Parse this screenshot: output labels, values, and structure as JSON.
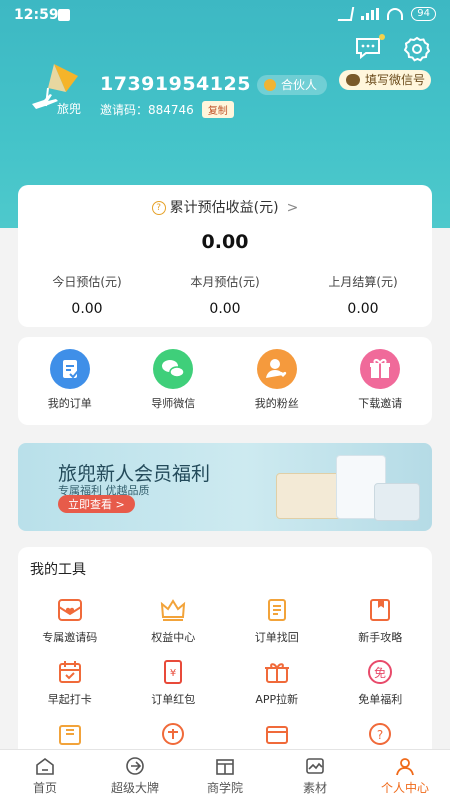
{
  "status_bar": {
    "time": "12:59",
    "battery": "94"
  },
  "colors": {
    "header": "#44c3c9",
    "accent": "#f06a1a",
    "badge_bg": "#fff6dc"
  },
  "header": {
    "phone": "17391954125",
    "partner_badge": "合伙人",
    "wechat_button": "填写微信号",
    "invite_label": "邀请码：884746",
    "copy_label": "复制",
    "logo_text": "旅兜"
  },
  "earnings": {
    "title": "累计预估收益(元)",
    "total": "0.00",
    "columns": [
      {
        "label": "今日预估(元)",
        "value": "0.00"
      },
      {
        "label": "本月预估(元)",
        "value": "0.00"
      },
      {
        "label": "上月结算(元)",
        "value": "0.00"
      }
    ]
  },
  "quick_links": [
    {
      "label": "我的订单",
      "icon": "order-icon",
      "color": "#3f8fe8"
    },
    {
      "label": "导师微信",
      "icon": "wechat-icon",
      "color": "#3fcf7a"
    },
    {
      "label": "我的粉丝",
      "icon": "fans-icon",
      "color": "#f59a3d"
    },
    {
      "label": "下载邀请",
      "icon": "gift-icon",
      "color": "#f06a9a"
    }
  ],
  "banner": {
    "title": "旅兜新人会员福利",
    "subtitle": "专属福利 优越品质",
    "button": "立即查看 >"
  },
  "tools": {
    "title": "我的工具",
    "items": [
      {
        "label": "专属邀请码",
        "icon": "invite-code-icon"
      },
      {
        "label": "权益中心",
        "icon": "crown-icon"
      },
      {
        "label": "订单找回",
        "icon": "order-recover-icon"
      },
      {
        "label": "新手攻略",
        "icon": "guide-icon"
      },
      {
        "label": "早起打卡",
        "icon": "checkin-icon"
      },
      {
        "label": "订单红包",
        "icon": "red-packet-icon"
      },
      {
        "label": "APP拉新",
        "icon": "app-invite-icon"
      },
      {
        "label": "免单福利",
        "icon": "free-order-icon"
      }
    ]
  },
  "tabbar": [
    {
      "label": "首页",
      "icon": "home-icon"
    },
    {
      "label": "超级大牌",
      "icon": "brand-icon"
    },
    {
      "label": "商学院",
      "icon": "school-icon"
    },
    {
      "label": "素材",
      "icon": "material-icon"
    },
    {
      "label": "个人中心",
      "icon": "profile-icon",
      "active": true
    }
  ]
}
